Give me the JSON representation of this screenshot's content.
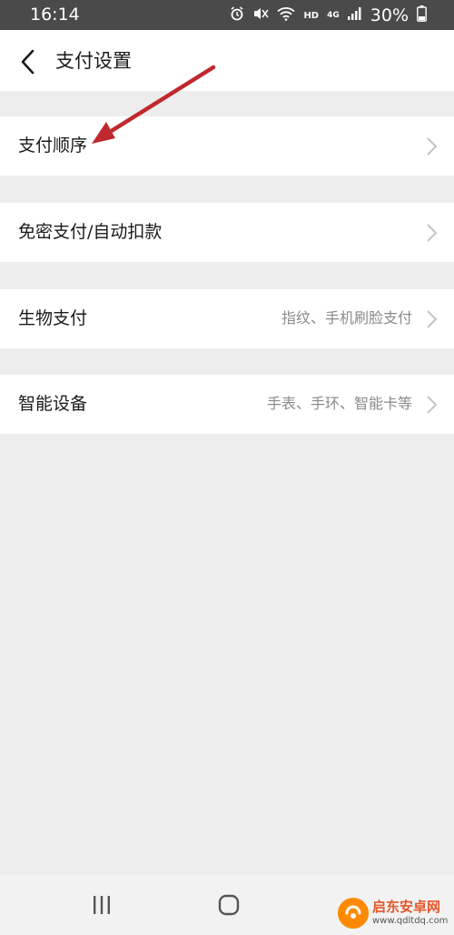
{
  "status_bar": {
    "time": "16:14",
    "network_hd": "HD",
    "network_gen": "4G",
    "battery": "30%"
  },
  "header": {
    "title": "支付设置",
    "back_icon": "chevron-left-icon"
  },
  "settings": [
    {
      "label": "支付顺序",
      "detail": ""
    },
    {
      "label": "免密支付/自动扣款",
      "detail": ""
    },
    {
      "label": "生物支付",
      "detail": "指纹、手机刷脸支付"
    },
    {
      "label": "智能设备",
      "detail": "手表、手环、智能卡等"
    }
  ],
  "annotation": {
    "color": "#c0282d"
  },
  "watermark": {
    "title": "启东安卓网",
    "url": "www.qdltdq.com"
  },
  "colors": {
    "background": "#ededed",
    "card": "#ffffff",
    "status_bar": "#4a4a4a",
    "secondary_text": "#8a8a8a"
  }
}
